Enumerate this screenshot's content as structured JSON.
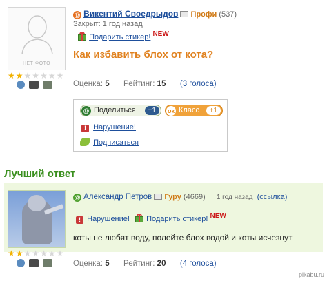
{
  "question_block": {
    "avatar_caption": "НЕТ ФОТО",
    "stars_on": 2,
    "stars_total": 7,
    "user_name": "Викентий Своедрыдов",
    "rank": "Профи",
    "rank_count": "(537)",
    "closed": "Закрыт: 1 год назад",
    "gift_link": "Подарить стикер!",
    "new_badge": "NEW",
    "question": "Как избавить блох от кота?",
    "score_label": "Оценка:",
    "score_value": "5",
    "rating_label": "Рейтинг:",
    "rating_value": "15",
    "votes_link": "(3 голоса)"
  },
  "share_panel": {
    "share_label": "Поделиться",
    "share_count": "+1",
    "klass_label": "Класс",
    "klass_count": "+1",
    "report_link": "Нарушение!",
    "subscribe_link": "Подписаться"
  },
  "best_answer": {
    "section_title": "Лучший ответ",
    "user_name": "Александр Петров",
    "rank": "Гуру",
    "rank_count": "(4669)",
    "time": "1 год назад",
    "link": "(ссылка)",
    "report_link": "Нарушение!",
    "gift_link": "Подарить стикер!",
    "new_badge": "NEW",
    "answer": "коты не любят воду, полейте блох водой и коты исчезнут",
    "stars_on": 2,
    "stars_total": 7,
    "score_label": "Оценка:",
    "score_value": "5",
    "rating_label": "Рейтинг:",
    "rating_value": "20",
    "votes_link": "(4 голоса)"
  },
  "watermark": "pikabu.ru",
  "colors": {
    "link": "#1e4f9c",
    "question": "#e0811e",
    "section_title": "#3a8f1e",
    "answer_band": "#eef7df"
  }
}
